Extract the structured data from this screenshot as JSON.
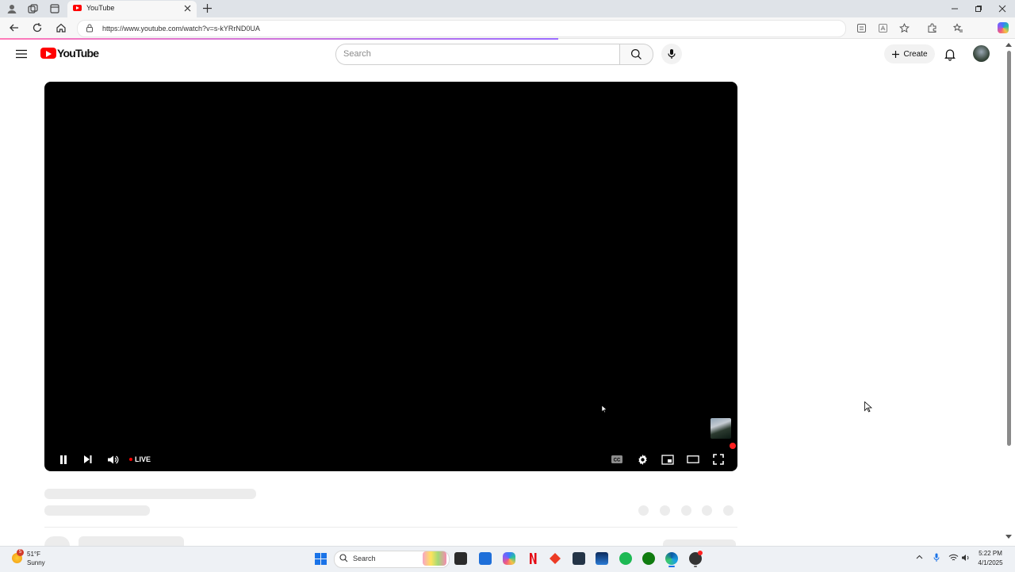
{
  "browser": {
    "tab_title": "YouTube",
    "url": "https://www.youtube.com/watch?v=s-kYRrND0UA"
  },
  "youtube": {
    "logo_text": "YouTube",
    "search_placeholder": "Search",
    "create_label": "Create"
  },
  "player": {
    "live_label": "LIVE"
  },
  "taskbar": {
    "weather_badge": "5",
    "weather_temp": "51°F",
    "weather_condition": "Sunny",
    "search_label": "Search",
    "time": "5:22 PM",
    "date": "4/1/2025"
  },
  "colors": {
    "yt_red": "#ff0000",
    "player_bg": "#000000",
    "progress_start": "#ff7ab8",
    "progress_end": "#9b6cff"
  }
}
